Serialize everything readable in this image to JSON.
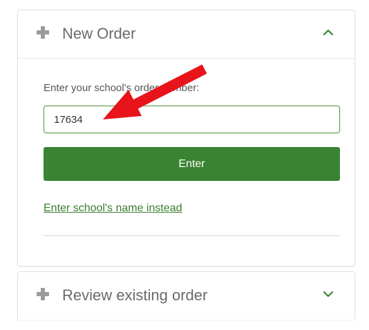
{
  "new_order": {
    "title": "New Order",
    "label": "Enter your school's order number:",
    "input_value": "17634",
    "enter_label": "Enter",
    "alt_link": "Enter school's name instead"
  },
  "review_order": {
    "title": "Review existing order"
  },
  "colors": {
    "accent": "#3a8332",
    "link": "#3a7d2f",
    "annotation_arrow": "#e8141b"
  },
  "icons": {
    "expand": "plus-icon",
    "collapse": "chevron-up-icon",
    "expand_down": "chevron-down-icon"
  }
}
